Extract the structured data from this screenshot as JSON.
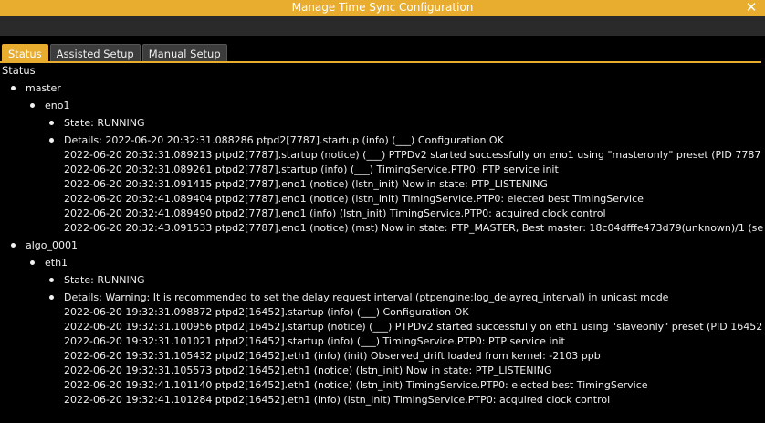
{
  "window": {
    "title": "Manage Time Sync Configuration",
    "close_glyph": "✕"
  },
  "tabs": [
    {
      "label": "Status",
      "active": true
    },
    {
      "label": "Assisted Setup",
      "active": false
    },
    {
      "label": "Manual Setup",
      "active": false
    }
  ],
  "status": {
    "heading": "Status",
    "groups": [
      {
        "name": "master",
        "interface": "eno1",
        "state": "State: RUNNING",
        "details_first": "Details: 2022-06-20 20:32:31.088286 ptpd2[7787].startup (info)      (___) Configuration OK",
        "lines": [
          "2022-06-20 20:32:31.089213 ptpd2[7787].startup (notice)     (___) PTPDv2 started successfully on eno1 using \"masteronly\" preset (PID 7787",
          "2022-06-20 20:32:31.089261 ptpd2[7787].startup (info)       (___) TimingService.PTP0: PTP service init",
          "2022-06-20 20:32:31.091415 ptpd2[7787].eno1 (notice)      (lstn_init) Now in state: PTP_LISTENING",
          "2022-06-20 20:32:41.089404 ptpd2[7787].eno1 (notice)      (lstn_init) TimingService.PTP0: elected best TimingService",
          "2022-06-20 20:32:41.089490 ptpd2[7787].eno1 (info)        (lstn_init) TimingService.PTP0: acquired clock control",
          "2022-06-20 20:32:43.091533 ptpd2[7787].eno1 (notice)      (mst) Now in state: PTP_MASTER, Best master: 18c04dfffe473d79(unknown)/1 (se"
        ]
      },
      {
        "name": "algo_0001",
        "interface": "eth1",
        "state": "State: RUNNING",
        "details_first": "Details: Warning: It is recommended to set the delay request interval (ptpengine:log_delayreq_interval) in unicast mode",
        "lines": [
          "2022-06-20 19:32:31.098872 ptpd2[16452].startup (info)      (___) Configuration OK",
          "2022-06-20 19:32:31.100956 ptpd2[16452].startup (notice)    (___) PTPDv2 started successfully on eth1 using \"slaveonly\" preset (PID 16452",
          "2022-06-20 19:32:31.101021 ptpd2[16452].startup (info)      (___) TimingService.PTP0: PTP service init",
          "2022-06-20 19:32:31.105432 ptpd2[16452].eth1 (info)       (init) Observed_drift loaded from kernel: -2103 ppb",
          "2022-06-20 19:32:31.105573 ptpd2[16452].eth1 (notice)     (lstn_init) Now in state: PTP_LISTENING",
          "2022-06-20 19:32:41.101140 ptpd2[16452].eth1 (notice)     (lstn_init) TimingService.PTP0: elected best TimingService",
          "2022-06-20 19:32:41.101284 ptpd2[16452].eth1 (info)       (lstn_init) TimingService.PTP0: acquired clock control"
        ]
      }
    ]
  },
  "colors": {
    "accent": "#e8ad2f",
    "background": "#000000",
    "tab_inactive": "#3c3c3c",
    "text": "#f0f0f0"
  }
}
